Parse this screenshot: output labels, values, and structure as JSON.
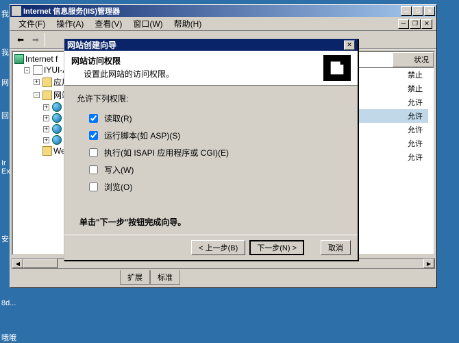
{
  "desktop": {
    "icon1": "我",
    "icon2": "我",
    "icon3": "回",
    "icon4": "Ir\nEx",
    "icon5": "网",
    "icon6": "安全",
    "bottom1": "8d...",
    "bottom2": "哦哦"
  },
  "window": {
    "title": "Internet 信息服务(IIS)管理器",
    "menu": {
      "file": "文件(F)",
      "action": "操作(A)",
      "view": "查看(V)",
      "window": "窗口(W)",
      "help": "帮助(H)"
    },
    "tabs": {
      "ext": "扩展",
      "std": "标准"
    }
  },
  "tree": {
    "root": "Internet f",
    "server": "IYUI-AE",
    "appPool": "应用",
    "webSites": "网站",
    "webExt": "Web"
  },
  "list": {
    "header": "状况",
    "rows": [
      "禁止",
      "禁止",
      "允许",
      "允许",
      "允许",
      "允许",
      "允许"
    ]
  },
  "wizard": {
    "title": "网站创建向导",
    "headerTitle": "网站访问权限",
    "headerSub": "设置此网站的访问权限。",
    "allowLabel": "允许下列权限:",
    "perms": {
      "read": {
        "label": "读取(R)",
        "checked": true
      },
      "script": {
        "label": "运行脚本(如 ASP)(S)",
        "checked": true
      },
      "execute": {
        "label": "执行(如 ISAPI 应用程序或 CGI)(E)",
        "checked": false
      },
      "write": {
        "label": "写入(W)",
        "checked": false
      },
      "browse": {
        "label": "浏览(O)",
        "checked": false
      }
    },
    "message": "单击\"下一步\"按钮完成向导。",
    "buttons": {
      "back": "< 上一步(B)",
      "next": "下一步(N) >",
      "cancel": "取消"
    }
  }
}
